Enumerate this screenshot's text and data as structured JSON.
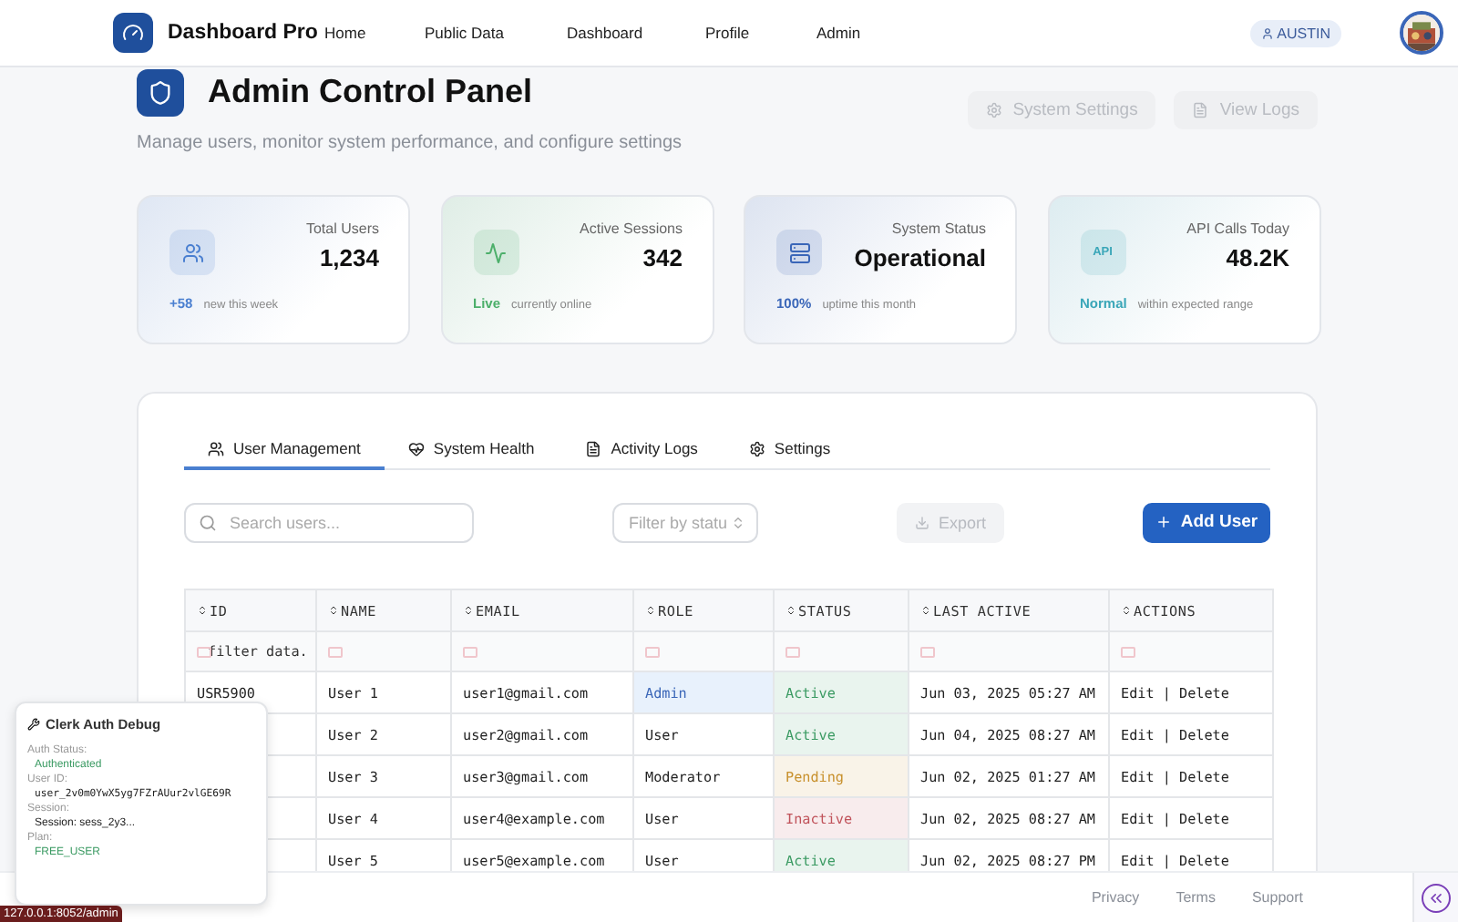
{
  "nav": {
    "brand": "Dashboard Pro",
    "links": [
      {
        "label": "Home",
        "selected": false
      },
      {
        "label": "Public Data",
        "selected": false
      },
      {
        "label": "Dashboard",
        "selected": false
      },
      {
        "label": "Profile",
        "selected": false
      },
      {
        "label": "Admin",
        "selected": false
      }
    ],
    "user": "AUSTIN"
  },
  "header": {
    "title": "Admin Control Panel",
    "subtitle": "Manage users, monitor system performance, and configure settings",
    "buttons": [
      {
        "label": "System Settings",
        "kind": "settings",
        "disabled": true
      },
      {
        "label": "View Logs",
        "kind": "logs",
        "disabled": true
      }
    ]
  },
  "stats": [
    {
      "kind": "users",
      "label": "Total Users",
      "value": "1,234",
      "highlight": "+58",
      "note": "new this week",
      "color": "#4a7fd0"
    },
    {
      "kind": "activity",
      "label": "Active Sessions",
      "value": "342",
      "highlight": "Live",
      "note": "currently online",
      "color": "#4caf6a"
    },
    {
      "kind": "server",
      "label": "System Status",
      "value": "Operational",
      "highlight": "100%",
      "note": "uptime this month",
      "color": "#3a66b8"
    },
    {
      "kind": "api",
      "label": "API Calls Today",
      "value": "48.2K",
      "highlight": "Normal",
      "note": "within expected range",
      "color": "#3aa6b8",
      "icon_label": "API"
    }
  ],
  "tabs": [
    {
      "label": "User Management",
      "kind": "users",
      "selected": true
    },
    {
      "label": "System Health",
      "kind": "health",
      "selected": false
    },
    {
      "label": "Activity Logs",
      "kind": "logs",
      "selected": false
    },
    {
      "label": "Settings",
      "kind": "settings",
      "selected": false
    }
  ],
  "toolbar": {
    "search": {
      "placeholder": "Search users..."
    },
    "filter": {
      "placeholder": "Filter by statu"
    },
    "export": {
      "label": "Export",
      "disabled": true
    },
    "add": {
      "label": "Add User",
      "disabled": false
    }
  },
  "table": {
    "columns": [
      "ID",
      "NAME",
      "EMAIL",
      "ROLE",
      "STATUS",
      "LAST ACTIVE",
      "ACTIONS"
    ],
    "filter_placeholder": "filter data.",
    "rows": [
      {
        "id": "USR5900",
        "name": "User 1",
        "email": "user1@gmail.com",
        "role": {
          "text": "Admin",
          "highlighted": true
        },
        "status": {
          "text": "Active",
          "color": "#3a9a62"
        },
        "last_active": "Jun 03, 2025 05:27 AM",
        "actions": "Edit | Delete"
      },
      {
        "name": "User 2",
        "email": "user2@gmail.com",
        "role": {
          "text": "User",
          "highlighted": false
        },
        "status": {
          "text": "Active",
          "color": "#3a9a62"
        },
        "last_active": "Jun 04, 2025 08:27 AM",
        "actions": "Edit | Delete"
      },
      {
        "name": "User 3",
        "email": "user3@gmail.com",
        "role": {
          "text": "Moderator",
          "highlighted": false
        },
        "status": {
          "text": "Pending",
          "color": "#c8902c"
        },
        "last_active": "Jun 02, 2025 01:27 AM",
        "actions": "Edit | Delete"
      },
      {
        "name": "User 4",
        "email": "user4@example.com",
        "role": {
          "text": "User",
          "highlighted": false
        },
        "status": {
          "text": "Inactive",
          "color": "#c0525a"
        },
        "last_active": "Jun 02, 2025 08:27 AM",
        "actions": "Edit | Delete"
      },
      {
        "name": "User 5",
        "email": "user5@example.com",
        "role": {
          "text": "User",
          "highlighted": false
        },
        "status": {
          "text": "Active",
          "color": "#3a9a62"
        },
        "last_active": "Jun 02, 2025 08:27 PM",
        "actions": "Edit | Delete"
      }
    ]
  },
  "footer": {
    "links": [
      "Privacy",
      "Terms",
      "Support"
    ]
  },
  "debug": {
    "title": "Clerk Auth Debug",
    "fields": [
      {
        "label": "Auth Status:",
        "value": "Authenticated",
        "color": "#3a9a62"
      },
      {
        "label": "User ID:",
        "value": "user_2v0m0YwX5yg7FZrAUur2vlGE69R",
        "color": "#222222"
      },
      {
        "label": "Session:",
        "value": "Session: sess_2y3...",
        "color": "#222222"
      },
      {
        "label": "Plan:",
        "value": "FREE_USER",
        "color": "#3a9a62"
      }
    ]
  },
  "status_url": "127.0.0.1:8052/admin"
}
